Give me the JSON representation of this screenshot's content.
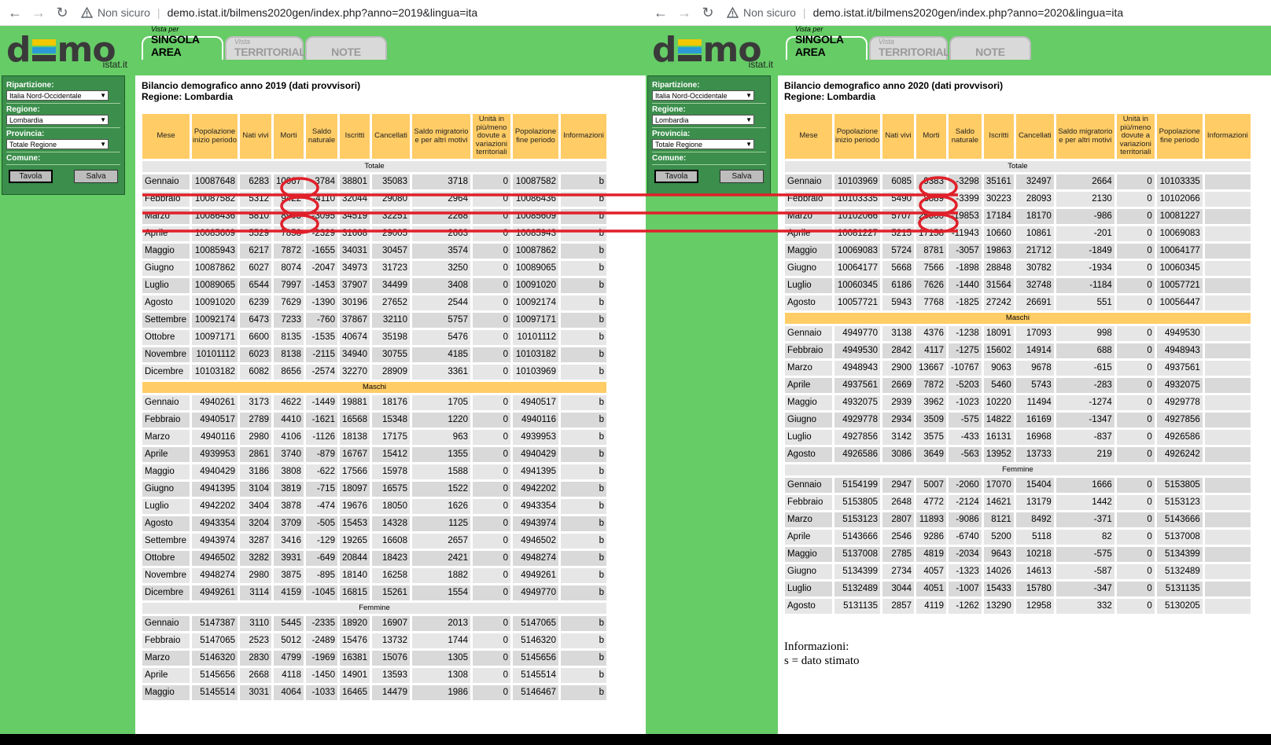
{
  "browser_left": {
    "security_text": "Non sicuro",
    "url": "demo.istat.it/bilmens2020gen/index.php?anno=2019&lingua=ita"
  },
  "browser_right": {
    "security_text": "Non sicuro",
    "url": "demo.istat.it/bilmens2020gen/index.php?anno=2020&lingua=ita"
  },
  "logo": {
    "word_left": "d",
    "word_right": "mo",
    "sub": "istat.it"
  },
  "tabs": {
    "singola_small": "Vista per",
    "singola_big": "SINGOLA AREA",
    "terr_small": "Vista",
    "terr_big": "TERRITORIALE",
    "note_big": "NOTE"
  },
  "sidebar": {
    "ripartizione_label": "Ripartizione:",
    "ripartizione_value": "Italia Nord-Occidentale",
    "regione_label": "Regione:",
    "regione_value": "Lombardia",
    "provincia_label": "Provincia:",
    "provincia_value": "Totale Regione",
    "comune_label": "Comune:",
    "tavola_label": "Tavola",
    "salva_label": "Salva"
  },
  "headers": [
    "Mese",
    "Popolazione inizio periodo",
    "Nati vivi",
    "Morti",
    "Saldo naturale",
    "Iscritti",
    "Cancellati",
    "Saldo migratorio e per altri motivi",
    "Unità in più/meno dovute a variazioni territoriali",
    "Popolazione fine periodo",
    "Informazioni"
  ],
  "left": {
    "title1": "Bilancio demografico anno 2019 (dati provvisori)",
    "title2": "Regione: Lombardia",
    "sections": [
      {
        "label": "Totale",
        "rows": [
          [
            "Gennaio",
            "10087648",
            "6283",
            "10067",
            "-3784",
            "38801",
            "35083",
            "3718",
            "0",
            "10087582",
            "b"
          ],
          [
            "Febbraio",
            "10087582",
            "5312",
            "9422",
            "-4110",
            "32044",
            "29080",
            "2964",
            "0",
            "10086436",
            "b"
          ],
          [
            "Marzo",
            "10086436",
            "5810",
            "8905",
            "-3095",
            "34519",
            "32251",
            "2268",
            "0",
            "10085609",
            "b"
          ],
          [
            "Aprile",
            "10085609",
            "5529",
            "7858",
            "-2329",
            "31668",
            "29005",
            "2663",
            "0",
            "10085943",
            "b"
          ],
          [
            "Maggio",
            "10085943",
            "6217",
            "7872",
            "-1655",
            "34031",
            "30457",
            "3574",
            "0",
            "10087862",
            "b"
          ],
          [
            "Giugno",
            "10087862",
            "6027",
            "8074",
            "-2047",
            "34973",
            "31723",
            "3250",
            "0",
            "10089065",
            "b"
          ],
          [
            "Luglio",
            "10089065",
            "6544",
            "7997",
            "-1453",
            "37907",
            "34499",
            "3408",
            "0",
            "10091020",
            "b"
          ],
          [
            "Agosto",
            "10091020",
            "6239",
            "7629",
            "-1390",
            "30196",
            "27652",
            "2544",
            "0",
            "10092174",
            "b"
          ],
          [
            "Settembre",
            "10092174",
            "6473",
            "7233",
            "-760",
            "37867",
            "32110",
            "5757",
            "0",
            "10097171",
            "b"
          ],
          [
            "Ottobre",
            "10097171",
            "6600",
            "8135",
            "-1535",
            "40674",
            "35198",
            "5476",
            "0",
            "10101112",
            "b"
          ],
          [
            "Novembre",
            "10101112",
            "6023",
            "8138",
            "-2115",
            "34940",
            "30755",
            "4185",
            "0",
            "10103182",
            "b"
          ],
          [
            "Dicembre",
            "10103182",
            "6082",
            "8656",
            "-2574",
            "32270",
            "28909",
            "3361",
            "0",
            "10103969",
            "b"
          ]
        ]
      },
      {
        "label": "Maschi",
        "rows": [
          [
            "Gennaio",
            "4940261",
            "3173",
            "4622",
            "-1449",
            "19881",
            "18176",
            "1705",
            "0",
            "4940517",
            "b"
          ],
          [
            "Febbraio",
            "4940517",
            "2789",
            "4410",
            "-1621",
            "16568",
            "15348",
            "1220",
            "0",
            "4940116",
            "b"
          ],
          [
            "Marzo",
            "4940116",
            "2980",
            "4106",
            "-1126",
            "18138",
            "17175",
            "963",
            "0",
            "4939953",
            "b"
          ],
          [
            "Aprile",
            "4939953",
            "2861",
            "3740",
            "-879",
            "16767",
            "15412",
            "1355",
            "0",
            "4940429",
            "b"
          ],
          [
            "Maggio",
            "4940429",
            "3186",
            "3808",
            "-622",
            "17566",
            "15978",
            "1588",
            "0",
            "4941395",
            "b"
          ],
          [
            "Giugno",
            "4941395",
            "3104",
            "3819",
            "-715",
            "18097",
            "16575",
            "1522",
            "0",
            "4942202",
            "b"
          ],
          [
            "Luglio",
            "4942202",
            "3404",
            "3878",
            "-474",
            "19676",
            "18050",
            "1626",
            "0",
            "4943354",
            "b"
          ],
          [
            "Agosto",
            "4943354",
            "3204",
            "3709",
            "-505",
            "15453",
            "14328",
            "1125",
            "0",
            "4943974",
            "b"
          ],
          [
            "Settembre",
            "4943974",
            "3287",
            "3416",
            "-129",
            "19265",
            "16608",
            "2657",
            "0",
            "4946502",
            "b"
          ],
          [
            "Ottobre",
            "4946502",
            "3282",
            "3931",
            "-649",
            "20844",
            "18423",
            "2421",
            "0",
            "4948274",
            "b"
          ],
          [
            "Novembre",
            "4948274",
            "2980",
            "3875",
            "-895",
            "18140",
            "16258",
            "1882",
            "0",
            "4949261",
            "b"
          ],
          [
            "Dicembre",
            "4949261",
            "3114",
            "4159",
            "-1045",
            "16815",
            "15261",
            "1554",
            "0",
            "4949770",
            "b"
          ]
        ]
      },
      {
        "label": "Femmine",
        "rows": [
          [
            "Gennaio",
            "5147387",
            "3110",
            "5445",
            "-2335",
            "18920",
            "16907",
            "2013",
            "0",
            "5147065",
            "b"
          ],
          [
            "Febbraio",
            "5147065",
            "2523",
            "5012",
            "-2489",
            "15476",
            "13732",
            "1744",
            "0",
            "5146320",
            "b"
          ],
          [
            "Marzo",
            "5146320",
            "2830",
            "4799",
            "-1969",
            "16381",
            "15076",
            "1305",
            "0",
            "5145656",
            "b"
          ],
          [
            "Aprile",
            "5145656",
            "2668",
            "4118",
            "-1450",
            "14901",
            "13593",
            "1308",
            "0",
            "5145514",
            "b"
          ],
          [
            "Maggio",
            "5145514",
            "3031",
            "4064",
            "-1033",
            "16465",
            "14479",
            "1986",
            "0",
            "5146467",
            "b"
          ]
        ]
      }
    ]
  },
  "right": {
    "title1": "Bilancio demografico anno 2020 (dati provvisori)",
    "title2": "Regione: Lombardia",
    "sections": [
      {
        "label": "Totale",
        "rows": [
          [
            "Gennaio",
            "10103969",
            "6085",
            "9383",
            "-3298",
            "35161",
            "32497",
            "2664",
            "0",
            "10103335",
            ""
          ],
          [
            "Febbraio",
            "10103335",
            "5490",
            "8889",
            "-3399",
            "30223",
            "28093",
            "2130",
            "0",
            "10102066",
            ""
          ],
          [
            "Marzo",
            "10102066",
            "5707",
            "25560",
            "-19853",
            "17184",
            "18170",
            "-986",
            "0",
            "10081227",
            ""
          ],
          [
            "Aprile",
            "10081227",
            "5215",
            "17158",
            "-11943",
            "10660",
            "10861",
            "-201",
            "0",
            "10069083",
            ""
          ],
          [
            "Maggio",
            "10069083",
            "5724",
            "8781",
            "-3057",
            "19863",
            "21712",
            "-1849",
            "0",
            "10064177",
            ""
          ],
          [
            "Giugno",
            "10064177",
            "5668",
            "7566",
            "-1898",
            "28848",
            "30782",
            "-1934",
            "0",
            "10060345",
            ""
          ],
          [
            "Luglio",
            "10060345",
            "6186",
            "7626",
            "-1440",
            "31564",
            "32748",
            "-1184",
            "0",
            "10057721",
            ""
          ],
          [
            "Agosto",
            "10057721",
            "5943",
            "7768",
            "-1825",
            "27242",
            "26691",
            "551",
            "0",
            "10056447",
            ""
          ]
        ]
      },
      {
        "label": "Maschi",
        "rows": [
          [
            "Gennaio",
            "4949770",
            "3138",
            "4376",
            "-1238",
            "18091",
            "17093",
            "998",
            "0",
            "4949530",
            ""
          ],
          [
            "Febbraio",
            "4949530",
            "2842",
            "4117",
            "-1275",
            "15602",
            "14914",
            "688",
            "0",
            "4948943",
            ""
          ],
          [
            "Marzo",
            "4948943",
            "2900",
            "13667",
            "-10767",
            "9063",
            "9678",
            "-615",
            "0",
            "4937561",
            ""
          ],
          [
            "Aprile",
            "4937561",
            "2669",
            "7872",
            "-5203",
            "5460",
            "5743",
            "-283",
            "0",
            "4932075",
            ""
          ],
          [
            "Maggio",
            "4932075",
            "2939",
            "3962",
            "-1023",
            "10220",
            "11494",
            "-1274",
            "0",
            "4929778",
            ""
          ],
          [
            "Giugno",
            "4929778",
            "2934",
            "3509",
            "-575",
            "14822",
            "16169",
            "-1347",
            "0",
            "4927856",
            ""
          ],
          [
            "Luglio",
            "4927856",
            "3142",
            "3575",
            "-433",
            "16131",
            "16968",
            "-837",
            "0",
            "4926586",
            ""
          ],
          [
            "Agosto",
            "4926586",
            "3086",
            "3649",
            "-563",
            "13952",
            "13733",
            "219",
            "0",
            "4926242",
            ""
          ]
        ]
      },
      {
        "label": "Femmine",
        "rows": [
          [
            "Gennaio",
            "5154199",
            "2947",
            "5007",
            "-2060",
            "17070",
            "15404",
            "1666",
            "0",
            "5153805",
            ""
          ],
          [
            "Febbraio",
            "5153805",
            "2648",
            "4772",
            "-2124",
            "14621",
            "13179",
            "1442",
            "0",
            "5153123",
            ""
          ],
          [
            "Marzo",
            "5153123",
            "2807",
            "11893",
            "-9086",
            "8121",
            "8492",
            "-371",
            "0",
            "5143666",
            ""
          ],
          [
            "Aprile",
            "5143666",
            "2546",
            "9286",
            "-6740",
            "5200",
            "5118",
            "82",
            "0",
            "5137008",
            ""
          ],
          [
            "Maggio",
            "5137008",
            "2785",
            "4819",
            "-2034",
            "9643",
            "10218",
            "-575",
            "0",
            "5134399",
            ""
          ],
          [
            "Giugno",
            "5134399",
            "2734",
            "4057",
            "-1323",
            "14026",
            "14613",
            "-587",
            "0",
            "5132489",
            ""
          ],
          [
            "Luglio",
            "5132489",
            "3044",
            "4051",
            "-1007",
            "15433",
            "15780",
            "-347",
            "0",
            "5131135",
            ""
          ],
          [
            "Agosto",
            "5131135",
            "2857",
            "4119",
            "-1262",
            "13290",
            "12958",
            "332",
            "0",
            "5130205",
            ""
          ]
        ]
      }
    ],
    "info_title": "Informazioni:",
    "info_text": "s = dato stimato"
  },
  "colors": {
    "green": "#66cc66",
    "header": "#ffcc66",
    "annotation": "#e0202a"
  }
}
